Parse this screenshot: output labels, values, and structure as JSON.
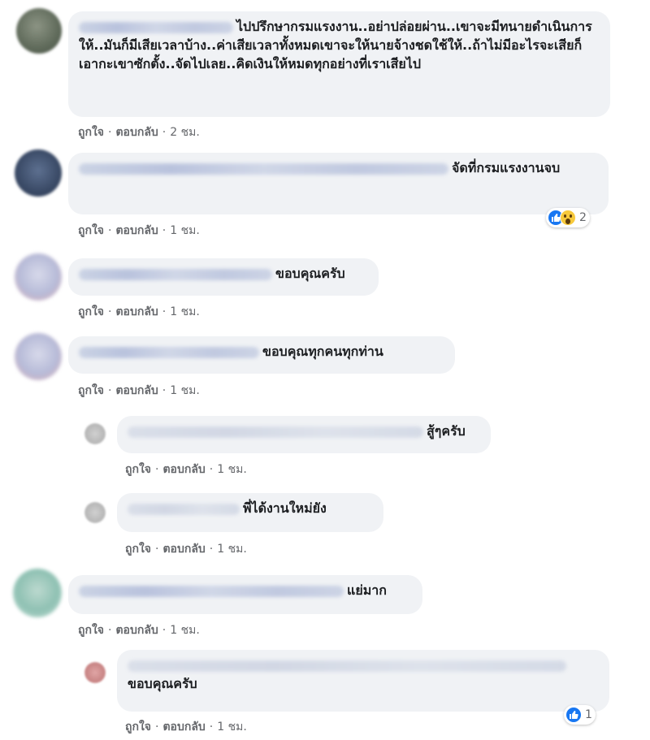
{
  "comments": [
    {
      "text": "ไปปรึกษากรมแรงงาน..อย่าปล่อยผ่าน..เขาจะมีทนายดำเนินการให้..มันก็มีเสียเวลาบ้าง..ค่าเสียเวลาทั้งหมดเขาจะให้นายจ้างชดใช้ให้..ถ้าไม่มีอะไรจะเสียก็เอากะเขาซักตั้ง..จัดไปเลย..คิดเงินให้หมดทุกอย่างที่เราเสียไป",
      "like": "ถูกใจ",
      "reply": "ตอบกลับ",
      "time": "2 ชม."
    },
    {
      "text": "จัดที่กรมแรงงานจบ",
      "like": "ถูกใจ",
      "reply": "ตอบกลับ",
      "time": "1 ชม.",
      "reaction_count": "2"
    },
    {
      "text": "ขอบคุณครับ",
      "like": "ถูกใจ",
      "reply": "ตอบกลับ",
      "time": "1 ชม."
    },
    {
      "text": "ขอบคุณทุกคนทุกท่าน",
      "like": "ถูกใจ",
      "reply": "ตอบกลับ",
      "time": "1 ชม."
    },
    {
      "text": "สู้ๆครับ",
      "like": "ถูกใจ",
      "reply": "ตอบกลับ",
      "time": "1 ชม."
    },
    {
      "text": "พี่ได้งานใหม่ยัง",
      "like": "ถูกใจ",
      "reply": "ตอบกลับ",
      "time": "1 ชม."
    },
    {
      "text": "แย่มาก",
      "like": "ถูกใจ",
      "reply": "ตอบกลับ",
      "time": "1 ชม."
    },
    {
      "text": "ขอบคุณครับ",
      "like": "ถูกใจ",
      "reply": "ตอบกลับ",
      "time": "1 ชม.",
      "reaction_count": "1"
    }
  ]
}
